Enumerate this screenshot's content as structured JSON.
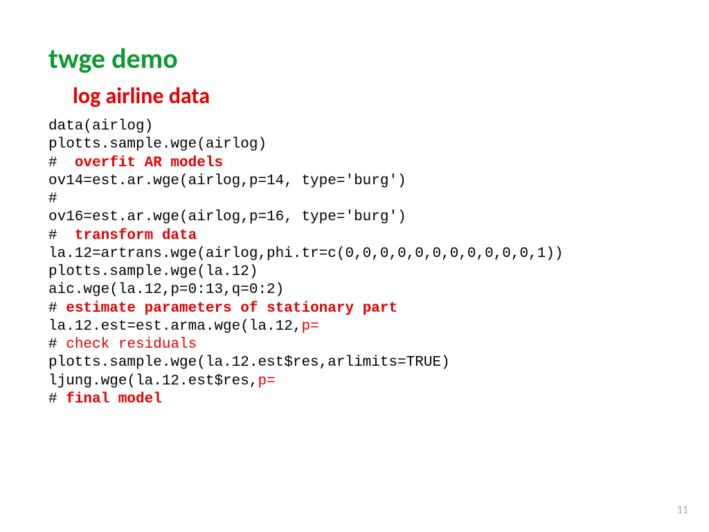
{
  "title": "twge demo",
  "subtitle": "log airline data",
  "code": {
    "l1": "data(airlog)",
    "l2": "plotts.sample.wge(airlog)",
    "l3a": "#  ",
    "l3b": "overfit AR models",
    "l4": "ov14=est.ar.wge(airlog,p=14, type='burg')",
    "l5": "#",
    "l6": "ov16=est.ar.wge(airlog,p=16, type='burg')",
    "l7a": "#  ",
    "l7b": "transform data",
    "l8": "la.12=artrans.wge(airlog,phi.tr=c(0,0,0,0,0,0,0,0,0,0,0,1))",
    "l9": "plotts.sample.wge(la.12)",
    "l10": "aic.wge(la.12,p=0:13,q=0:2)",
    "l11a": "# ",
    "l11b": "estimate parameters of stationary part",
    "l12a": "la.12.est=est.arma.wge(la.12,",
    "l12b": "p=",
    "l13a": "# ",
    "l13b": "check residuals",
    "l14": "plotts.sample.wge(la.12.est$res,arlimits=TRUE)",
    "l15a": "ljung.wge(la.12.est$res,",
    "l15b": "p=",
    "l16a": "# ",
    "l16b": "final model"
  },
  "page_number": "11"
}
